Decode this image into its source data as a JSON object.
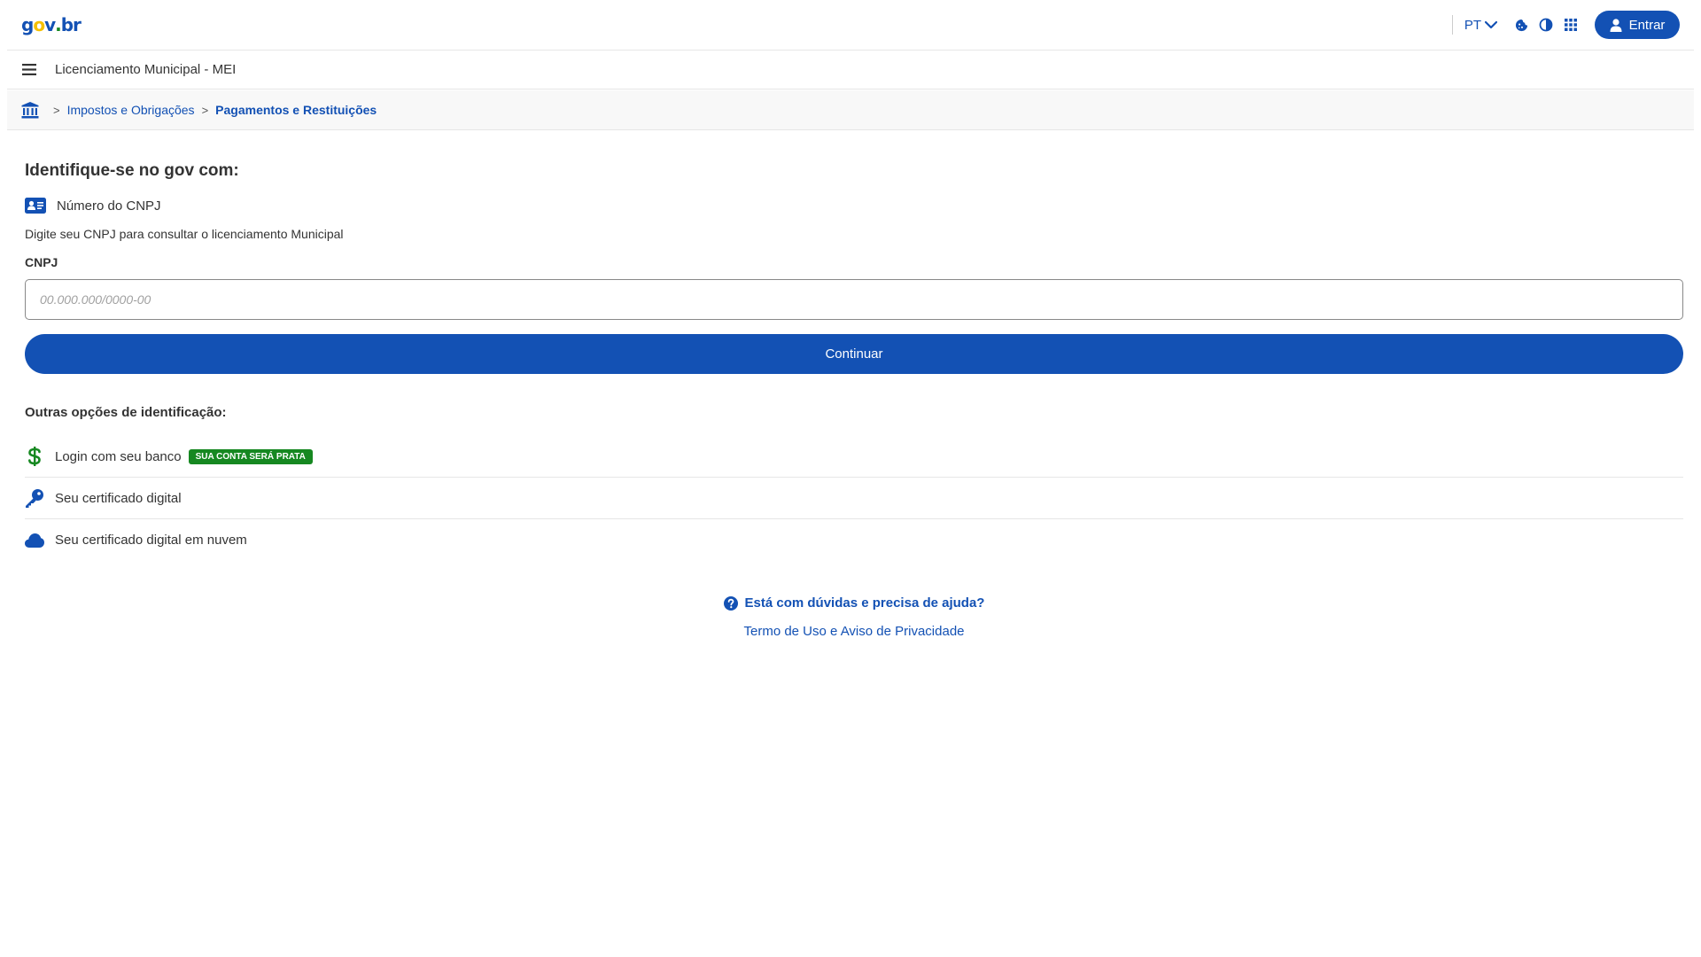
{
  "header": {
    "logo": {
      "g": "g",
      "o": "o",
      "v": "v",
      "dot": ".",
      "br": "br"
    },
    "language": "PT",
    "login_label": "Entrar"
  },
  "service": {
    "title": "Licenciamento Municipal - MEI"
  },
  "breadcrumb": {
    "items": [
      "Impostos e Obrigações",
      "Pagamentos e Restituições"
    ],
    "separator": ">"
  },
  "main": {
    "title": "Identifique-se no gov com:",
    "method_label": "Número do CNPJ",
    "description": "Digite seu CNPJ para consultar o licenciamento Municipal",
    "field_label": "CNPJ",
    "field_placeholder": "00.000.000/0000-00",
    "field_value": "",
    "continue_label": "Continuar"
  },
  "other_options": {
    "title": "Outras opções de identificação:",
    "items": [
      {
        "label": "Login com seu banco",
        "icon": "dollar-icon",
        "badge": "SUA CONTA SERÁ PRATA"
      },
      {
        "label": "Seu certificado digital",
        "icon": "key-icon"
      },
      {
        "label": "Seu certificado digital em nuvem",
        "icon": "cloud-icon"
      }
    ]
  },
  "footer": {
    "help_label": "Está com dúvidas e precisa de ajuda?",
    "terms_label": "Termo de Uso e Aviso de Privacidade"
  },
  "colors": {
    "primary": "#1351b4",
    "success": "#168821",
    "logo_yellow": "#f5c000"
  }
}
